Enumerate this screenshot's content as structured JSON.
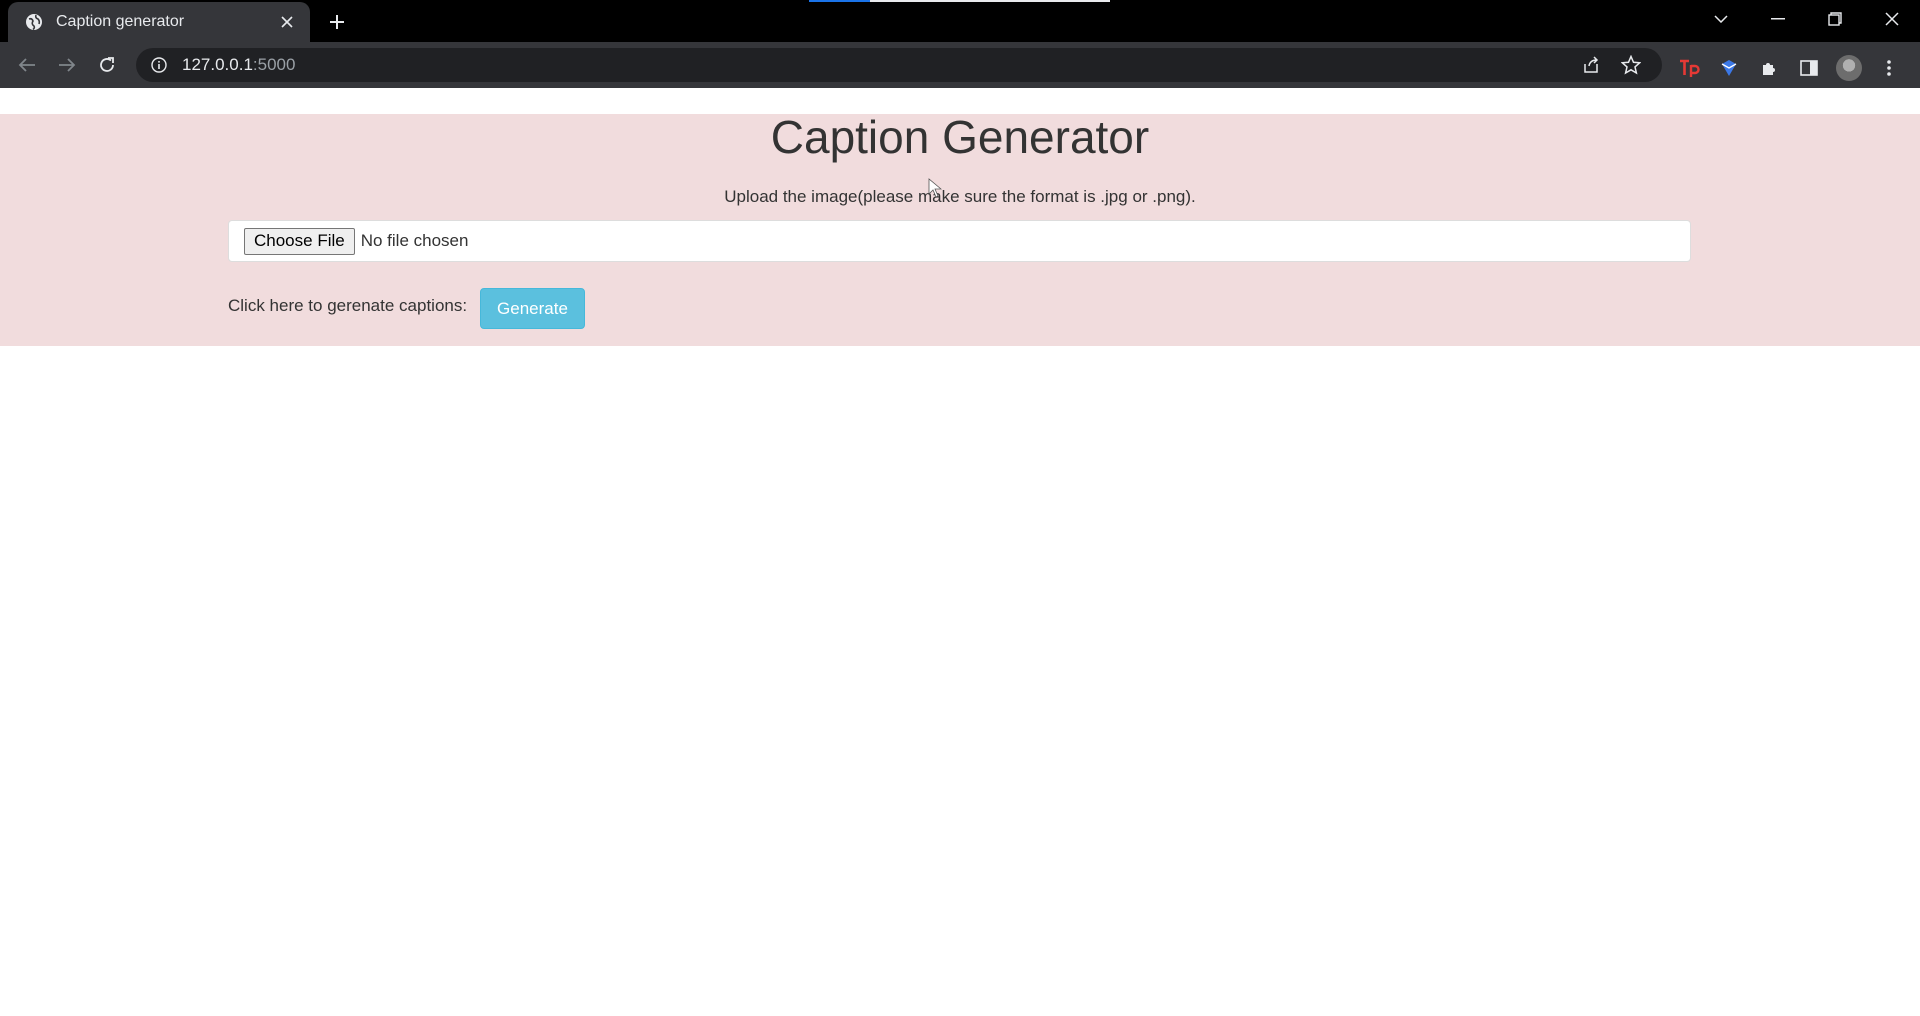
{
  "browser": {
    "tab": {
      "title": "Caption generator"
    },
    "address": {
      "host": "127.0.0.1",
      "port": ":5000"
    }
  },
  "page": {
    "title": "Caption Generator",
    "instruction": "Upload the image(please make sure the format is .jpg or .png).",
    "file_input": {
      "button_label": "Choose File",
      "status": "No file chosen"
    },
    "generate": {
      "label": "Click here to gerenate captions:",
      "button_label": "Generate"
    }
  },
  "colors": {
    "jumbotron_bg": "#f1dcdd",
    "generate_button": "#5bc0de",
    "chrome_dark": "#35363a"
  }
}
